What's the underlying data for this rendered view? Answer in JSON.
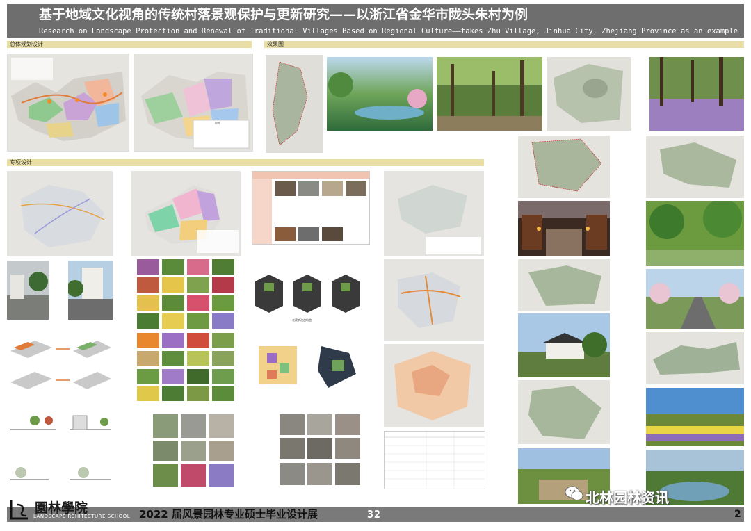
{
  "header": {
    "title_cn": "基于地域文化视角的传统村落景观保护与更新研究——以浙江省金华市陇头朱村为例",
    "title_en": "Research on Landscape Protection and Renewal of Traditional Villages Based on Regional Culture——takes Zhu Village, Jinhua City, Zhejiang Province as an example"
  },
  "sections": {
    "master_plan": "总体规划设计",
    "renderings": "效果图",
    "special_design": "专项设计"
  },
  "panels": {
    "legend_label": "图例",
    "building_facade_label": "老建筑改造构造"
  },
  "footer": {
    "school_cn": "園林學院",
    "school_en": "LANDSCAPE  RCHITECTURE SCHOOL",
    "exhibition": "2022 届风景园林专业硕士毕业设计展",
    "number": "32",
    "page": "2"
  },
  "watermark": {
    "text": "北林园林资讯"
  },
  "colors": {
    "title_bar": "#6e6e6e",
    "section_bar": "#e9dfa4",
    "footer_bar": "#7a7a7a"
  }
}
